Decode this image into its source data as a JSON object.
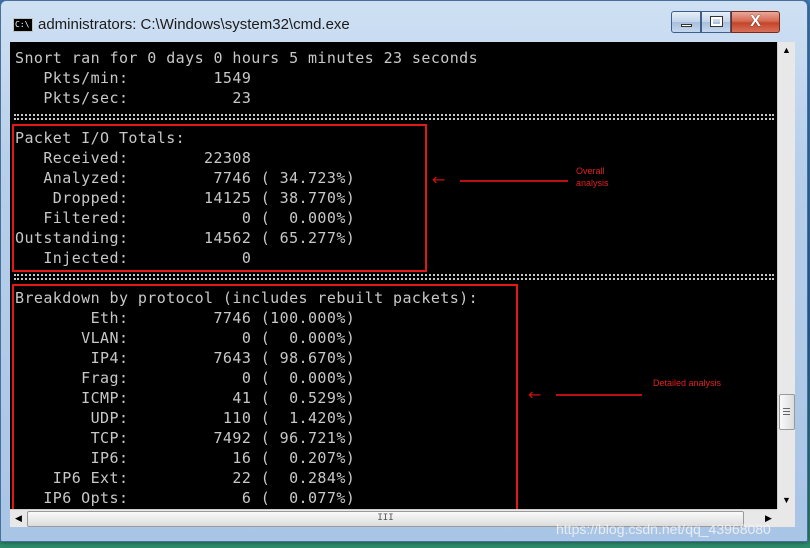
{
  "window": {
    "title": "administrators: C:\\Windows\\system32\\cmd.exe",
    "icon_label": "C:\\",
    "close_label": "X"
  },
  "console_lines": [
    "Snort ran for 0 days 0 hours 5 minutes 23 seconds",
    "   Pkts/min:         1549",
    "   Pkts/sec:           23",
    "Packet I/O Totals:",
    "   Received:        22308",
    "   Analyzed:         7746 ( 34.723%)",
    "    Dropped:        14125 ( 38.770%)",
    "   Filtered:            0 (  0.000%)",
    "Outstanding:        14562 ( 65.277%)",
    "   Injected:            0",
    "Breakdown by protocol (includes rebuilt packets):",
    "        Eth:         7746 (100.000%)",
    "       VLAN:            0 (  0.000%)",
    "        IP4:         7643 ( 98.670%)",
    "       Frag:            0 (  0.000%)",
    "       ICMP:           41 (  0.529%)",
    "        UDP:          110 (  1.420%)",
    "        TCP:         7492 ( 96.721%)",
    "        IP6:           16 (  0.207%)",
    "    IP6 Ext:           22 (  0.284%)",
    "   IP6 Opts:            6 (  0.077%)"
  ],
  "annotations": {
    "overall": {
      "arrow": "←",
      "text_line1": "Overall",
      "text_line2": "analysis",
      "color": "#e01818"
    },
    "detailed": {
      "arrow": "←",
      "text": "Detailed analysis",
      "color": "#e01818"
    }
  },
  "scrollbar": {
    "h_thumb_grip": "III"
  },
  "watermark": "https://blog.csdn.net/qq_43968080",
  "colors": {
    "console_bg": "#000000",
    "console_text": "#c8c8c8",
    "annotation_red": "#e01818"
  }
}
